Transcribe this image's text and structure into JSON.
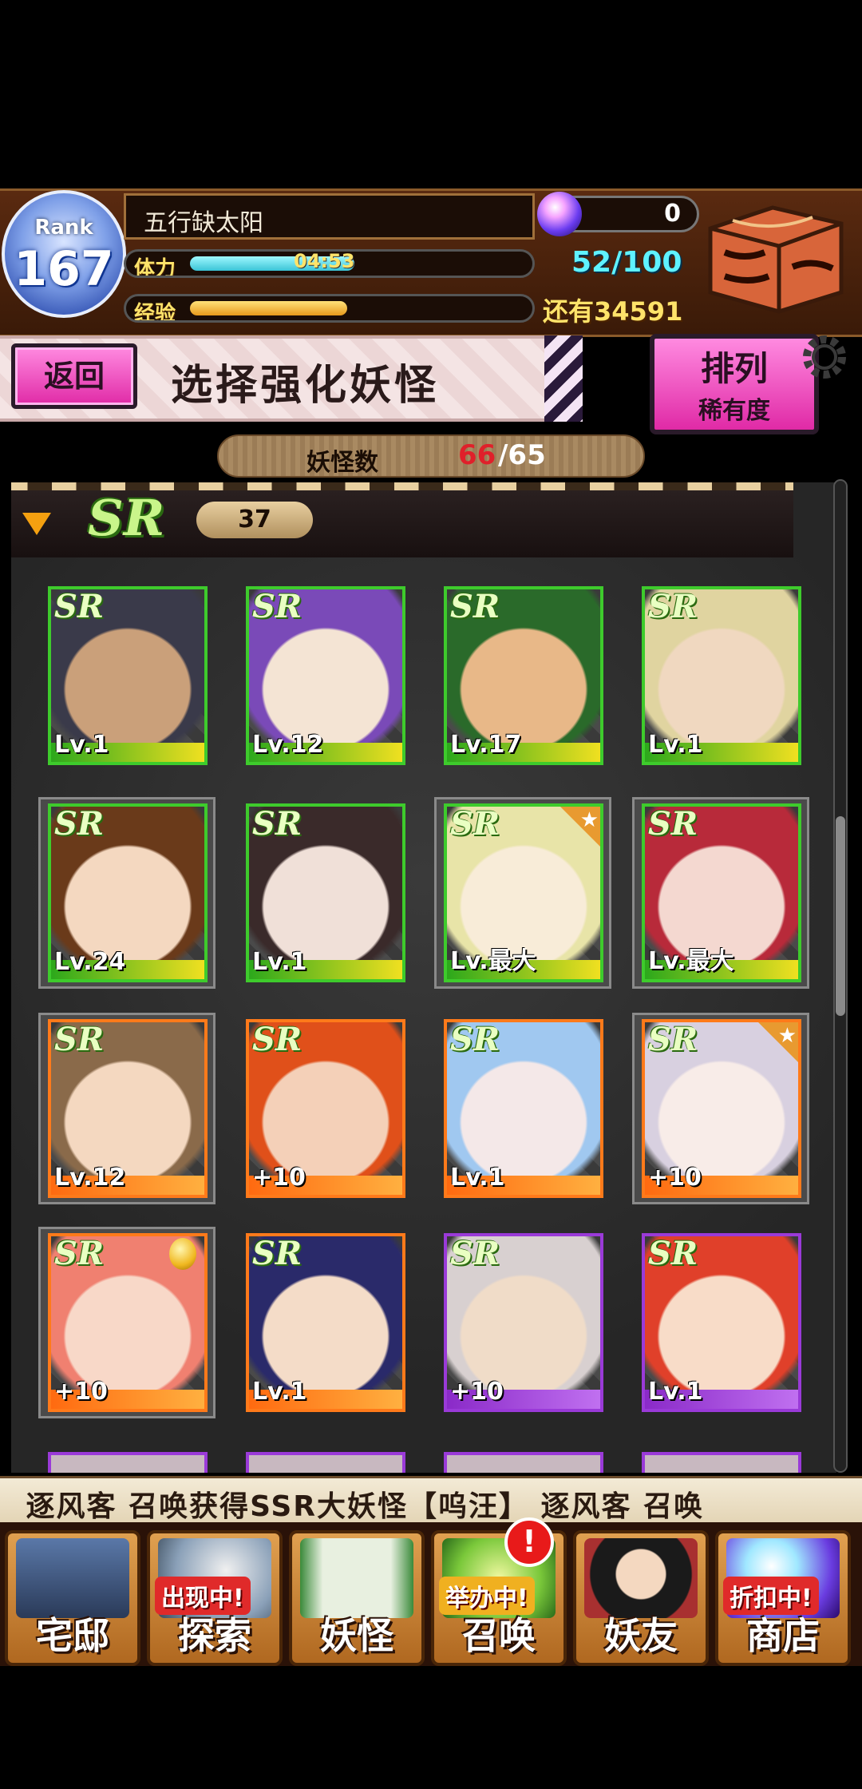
{
  "hud": {
    "rank_label": "Rank",
    "rank_value": "167",
    "player_name": "五行缺太阳",
    "stamina_label": "体力",
    "stamina_timer": "04:53",
    "stamina_fraction": 0.49,
    "exp_label": "经验",
    "exp_fraction": 0.47,
    "orb_count": "0",
    "box_count": "52/100",
    "remaining": "还有34591"
  },
  "title_row": {
    "back_label": "返回",
    "page_title": "选择强化妖怪",
    "sort_label": "排列",
    "sort_value": "稀有度"
  },
  "count_bar": {
    "label": "妖怪数",
    "current": "66",
    "max": "/65"
  },
  "section": {
    "rarity": "SR",
    "count": "37"
  },
  "cards": [
    {
      "rarity": "SR",
      "level": "Lv.1",
      "frame": "green",
      "selected": false,
      "star": false,
      "medal": false,
      "palette": [
        "#caa07a",
        "#3a3a4a"
      ]
    },
    {
      "rarity": "SR",
      "level": "Lv.12",
      "frame": "green",
      "selected": false,
      "star": false,
      "medal": false,
      "palette": [
        "#f4e4d4",
        "#7a4ab8"
      ]
    },
    {
      "rarity": "SR",
      "level": "Lv.17",
      "frame": "green",
      "selected": false,
      "star": false,
      "medal": false,
      "palette": [
        "#e8b888",
        "#2a6a2a"
      ]
    },
    {
      "rarity": "SR",
      "level": "Lv.1",
      "frame": "green",
      "selected": false,
      "star": false,
      "medal": false,
      "palette": [
        "#f0d8c0",
        "#e0d4a0"
      ]
    },
    {
      "rarity": "SR",
      "level": "Lv.24",
      "frame": "green",
      "selected": true,
      "star": false,
      "medal": false,
      "palette": [
        "#f4d8c0",
        "#6a3a1a"
      ]
    },
    {
      "rarity": "SR",
      "level": "Lv.1",
      "frame": "green",
      "selected": false,
      "star": false,
      "medal": false,
      "palette": [
        "#f0e0d8",
        "#3a2a2a"
      ]
    },
    {
      "rarity": "SR",
      "level": "Lv.最大",
      "frame": "green",
      "selected": true,
      "star": true,
      "medal": false,
      "palette": [
        "#f8ecd8",
        "#e8e4a8"
      ]
    },
    {
      "rarity": "SR",
      "level": "Lv.最大",
      "frame": "green",
      "selected": true,
      "star": false,
      "medal": false,
      "palette": [
        "#f4d8d0",
        "#b82a3a"
      ]
    },
    {
      "rarity": "SR",
      "level": "Lv.12",
      "frame": "orange",
      "selected": true,
      "star": false,
      "medal": false,
      "palette": [
        "#f4d8c0",
        "#8a6a4a"
      ]
    },
    {
      "rarity": "SR",
      "level": "+10",
      "frame": "orange",
      "selected": false,
      "star": false,
      "medal": false,
      "palette": [
        "#f4d0b8",
        "#e0501a"
      ]
    },
    {
      "rarity": "SR",
      "level": "Lv.1",
      "frame": "orange",
      "selected": false,
      "star": false,
      "medal": false,
      "palette": [
        "#f4e8e8",
        "#a0c8f0"
      ]
    },
    {
      "rarity": "SR",
      "level": "+10",
      "frame": "orange",
      "selected": true,
      "star": true,
      "medal": false,
      "palette": [
        "#f8ece8",
        "#d8d0e0"
      ]
    },
    {
      "rarity": "SR",
      "level": "+10",
      "frame": "orange",
      "selected": true,
      "star": false,
      "medal": true,
      "palette": [
        "#f8d8c8",
        "#f08070"
      ]
    },
    {
      "rarity": "SR",
      "level": "Lv.1",
      "frame": "orange",
      "selected": false,
      "star": false,
      "medal": false,
      "palette": [
        "#f4dcc8",
        "#2a2a6a"
      ]
    },
    {
      "rarity": "SR",
      "level": "+10",
      "frame": "purple",
      "selected": false,
      "star": false,
      "medal": false,
      "palette": [
        "#f0dcc8",
        "#d8d0d0"
      ]
    },
    {
      "rarity": "SR",
      "level": "Lv.1",
      "frame": "purple",
      "selected": false,
      "star": false,
      "medal": false,
      "palette": [
        "#f8dcc8",
        "#e0402a"
      ]
    }
  ],
  "ticker": {
    "text": "】  逐风客 召唤获得SSR大妖怪【呜汪】  逐风客 召唤"
  },
  "nav": [
    {
      "label": "宅邸",
      "badge": "",
      "art": "house-icon"
    },
    {
      "label": "探索",
      "badge": "出现中!",
      "art": "explore-icon"
    },
    {
      "label": "妖怪",
      "badge": "",
      "art": "yokai-scroll-icon"
    },
    {
      "label": "召唤",
      "badge": "举办中!",
      "art": "summon-icon"
    },
    {
      "label": "妖友",
      "badge": "",
      "art": "friend-icon"
    },
    {
      "label": "商店",
      "badge": "折扣中!",
      "art": "shop-orb-icon"
    }
  ],
  "summon_alert": "!"
}
